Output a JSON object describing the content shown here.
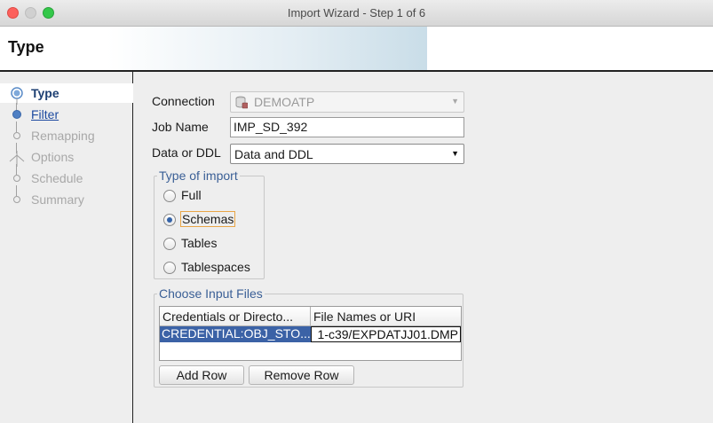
{
  "window": {
    "title": "Import Wizard - Step 1 of 6"
  },
  "header": {
    "title": "Type"
  },
  "steps": [
    {
      "label": "Type",
      "state": "current"
    },
    {
      "label": "Filter",
      "state": "link"
    },
    {
      "label": "Remapping",
      "state": "disabled"
    },
    {
      "label": "Options",
      "state": "disabled"
    },
    {
      "label": "Schedule",
      "state": "disabled"
    },
    {
      "label": "Summary",
      "state": "disabled"
    }
  ],
  "form": {
    "connection_label": "Connection",
    "connection_value": "DEMOATP",
    "job_name_label": "Job Name",
    "job_name_value": "IMP_SD_392",
    "data_or_ddl_label": "Data or DDL",
    "data_or_ddl_value": "Data and DDL"
  },
  "import_type": {
    "title": "Type of import",
    "options": [
      "Full",
      "Schemas",
      "Tables",
      "Tablespaces"
    ],
    "selected": "Schemas"
  },
  "input_files": {
    "title": "Choose Input Files",
    "columns": [
      "Credentials or Directo...",
      "File Names or URI"
    ],
    "rows": [
      [
        "CREDENTIAL:OBJ_STO...",
        "1-c39/EXPDATJJ01.DMP"
      ]
    ],
    "add_row_label": "Add Row",
    "remove_row_label": "Remove Row"
  },
  "colors": {
    "accent": "#3b62a6",
    "link": "#1d4aa0",
    "group_title": "#3a5f96",
    "focus": "#e8a547"
  }
}
